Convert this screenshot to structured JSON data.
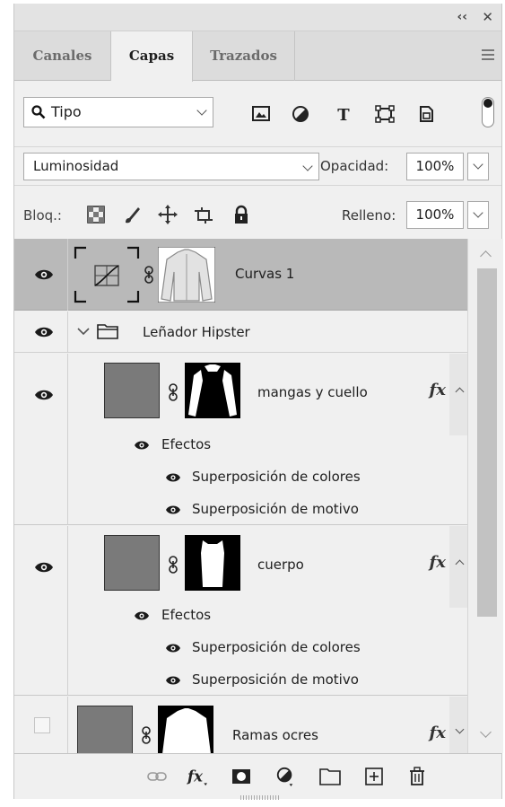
{
  "window": {
    "collapse_icon": "double-chevron-icon",
    "close_icon": "close-icon"
  },
  "tabs": [
    {
      "label": "Canales",
      "active": false
    },
    {
      "label": "Capas",
      "active": true
    },
    {
      "label": "Trazados",
      "active": false
    }
  ],
  "filter": {
    "kind_label": "Tipo",
    "icons": [
      "pixel-layer-filter-icon",
      "adjustment-layer-filter-icon",
      "type-layer-filter-icon",
      "shape-layer-filter-icon",
      "smart-object-filter-icon"
    ]
  },
  "blend": {
    "mode": "Luminosidad",
    "opacity_label": "Opacidad:",
    "opacity_value": "100%",
    "fill_label": "Relleno:",
    "fill_value": "100%"
  },
  "lock": {
    "label": "Bloq.:",
    "icons": [
      "lock-transparent-pixels-icon",
      "lock-image-pixels-icon",
      "lock-position-icon",
      "lock-artboard-icon",
      "lock-all-icon"
    ]
  },
  "layers": [
    {
      "name": "Curvas 1",
      "type": "adjustment",
      "visible": true,
      "selected": true
    },
    {
      "name": "Leñador Hipster",
      "type": "group",
      "visible": true,
      "expanded": true
    },
    {
      "name": "mangas y cuello",
      "type": "fill",
      "visible": true,
      "fx": "fx",
      "effects_label": "Efectos",
      "effects": [
        "Superposición de colores",
        "Superposición de motivo"
      ]
    },
    {
      "name": "cuerpo",
      "type": "fill",
      "visible": true,
      "fx": "fx",
      "effects_label": "Efectos",
      "effects": [
        "Superposición de colores",
        "Superposición de motivo"
      ]
    },
    {
      "name": "Ramas ocres",
      "type": "fill",
      "visible": false,
      "fx": "fx"
    }
  ],
  "bottom_toolbar": [
    "link-layers-icon",
    "add-style-icon",
    "add-mask-icon",
    "new-adjustment-icon",
    "new-group-icon",
    "new-layer-icon",
    "delete-layer-icon"
  ],
  "colors": {
    "panel_bg": "#f0f0f0",
    "selected_row": "#b9b9b9",
    "tab_bar": "#dcdcdc"
  }
}
